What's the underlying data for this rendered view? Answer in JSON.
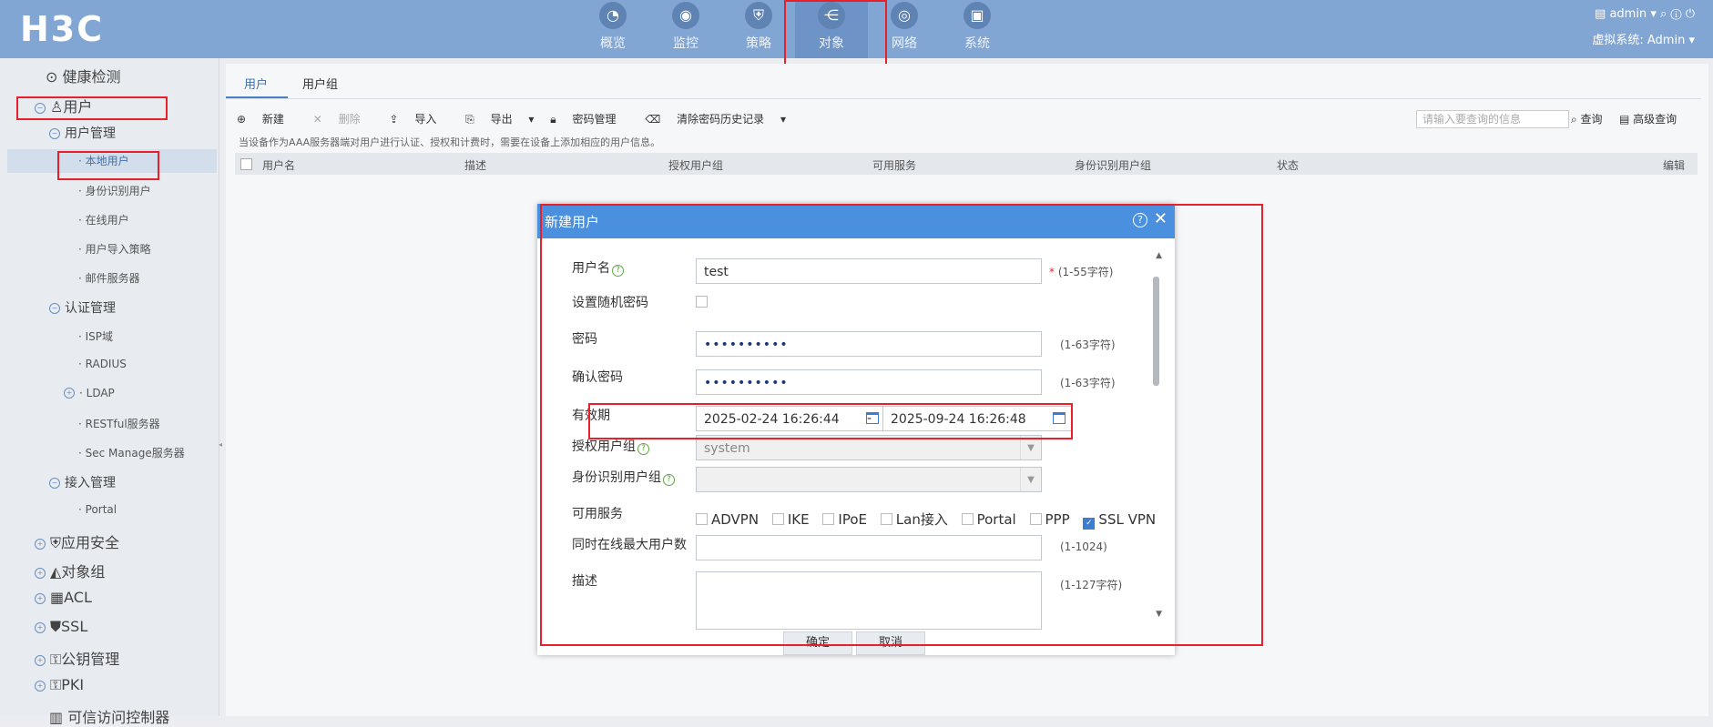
{
  "logo": "H3C",
  "nav": [
    {
      "label": "概览",
      "icon": "dashboard-icon",
      "glyph": "◔"
    },
    {
      "label": "监控",
      "icon": "camera-icon",
      "glyph": "◉"
    },
    {
      "label": "策略",
      "icon": "shield-icon",
      "glyph": "⛨"
    },
    {
      "label": "对象",
      "icon": "share-icon",
      "glyph": "⋲"
    },
    {
      "label": "网络",
      "icon": "globe-icon",
      "glyph": "◎"
    },
    {
      "label": "系统",
      "icon": "monitor-icon",
      "glyph": "▣"
    }
  ],
  "topright": {
    "user": "admin",
    "vsys_label": "虚拟系统: Admin"
  },
  "sidebar": {
    "health": "健康检测",
    "user": "用户",
    "user_mgmt": "用户管理",
    "local_user": "· 本地用户",
    "id_user": "· 身份识别用户",
    "online_user": "· 在线用户",
    "import_policy": "· 用户导入策略",
    "mail_server": "· 邮件服务器",
    "auth_mgmt": "认证管理",
    "isp": "· ISP域",
    "radius": "· RADIUS",
    "ldap": "· LDAP",
    "restful": "· RESTful服务器",
    "secmanage": "· Sec Manage服务器",
    "access_mgmt": "接入管理",
    "portal": "· Portal",
    "app_security": "应用安全",
    "obj_group": "对象组",
    "acl": "ACL",
    "ssl": "SSL",
    "pki_mgmt": "公钥管理",
    "pki": "PKI",
    "trusted": "可信访问控制器"
  },
  "tabs": [
    "用户",
    "用户组"
  ],
  "toolbar": {
    "new": "新建",
    "delete": "删除",
    "import": "导入",
    "export": "导出",
    "pwd_mgmt": "密码管理",
    "clear_pwd": "清除密码历史记录"
  },
  "hint": "当设备作为AAA服务器端对用户进行认证、授权和计费时，需要在设备上添加相应的用户信息。",
  "search": {
    "placeholder": "请输入要查询的信息",
    "query": "查询",
    "advanced": "高级查询"
  },
  "table_headers": [
    "用户名",
    "描述",
    "授权用户组",
    "可用服务",
    "身份识别用户组",
    "状态",
    "编辑"
  ],
  "dialog": {
    "title": "新建用户",
    "username_label": "用户名",
    "username_value": "test",
    "username_range": "(1-55字符)",
    "random_pwd_label": "设置随机密码",
    "password_label": "密码",
    "password_value": "••••••••••",
    "password_range": "(1-63字符)",
    "confirm_label": "确认密码",
    "confirm_value": "••••••••••",
    "confirm_range": "(1-63字符)",
    "validity_label": "有效期",
    "start_date": "2025-02-24 16:26:44",
    "end_date": "2025-09-24 16:26:48",
    "date_sep": "-",
    "auth_group_label": "授权用户组",
    "auth_group_value": "system",
    "id_group_label": "身份识别用户组",
    "services_label": "可用服务",
    "services": [
      {
        "label": "ADVPN",
        "checked": false
      },
      {
        "label": "IKE",
        "checked": false
      },
      {
        "label": "IPoE",
        "checked": false
      },
      {
        "label": "Lan接入",
        "checked": false
      },
      {
        "label": "Portal",
        "checked": false
      },
      {
        "label": "PPP",
        "checked": false
      },
      {
        "label": "SSL VPN",
        "checked": true
      }
    ],
    "max_online_label": "同时在线最大用户数",
    "max_online_range": "(1-1024)",
    "desc_label": "描述",
    "desc_range": "(1-127字符)",
    "ok": "确定",
    "cancel": "取消"
  }
}
